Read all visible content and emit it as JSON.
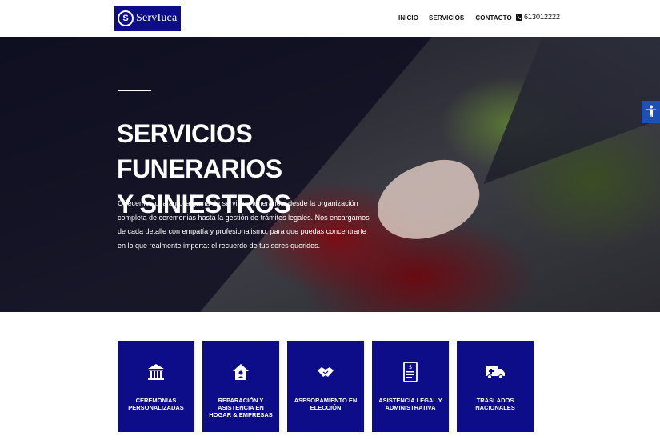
{
  "header": {
    "logo_text": "ServIuca",
    "nav": [
      {
        "label": "INICIO"
      },
      {
        "label": "SERVICIOS"
      },
      {
        "label": "CONTACTO"
      }
    ],
    "phone": "613012222"
  },
  "hero": {
    "title_line1": "SERVICIOS FUNERARIOS",
    "title_line2": "Y SINIESTROS",
    "description": "Ofrecemos una amplia gama de servicios funerarios, desde la organización completa de ceremonias hasta la gestión de trámites legales. Nos encargamos de cada detalle con empatía y profesionalismo, para que puedas concentrarte en lo que realmente importa: el recuerdo de tus seres queridos."
  },
  "services": [
    {
      "label": "CEREMONIAS PERSONALIZADAS",
      "icon": "bank-building-icon"
    },
    {
      "label": "REPARACIÓN Y ASISTENCIA EN HOGAR & EMPRESAS",
      "icon": "home-user-icon"
    },
    {
      "label": "ASESORAMIENTO EN ELECCIÓN",
      "icon": "handshake-icon"
    },
    {
      "label": "ASISTENCIA LEGAL Y ADMINISTRATIVA",
      "icon": "document-dollar-icon"
    },
    {
      "label": "TRASLADOS NACIONALES",
      "icon": "ambulance-icon"
    }
  ],
  "colors": {
    "brand": "#0d0d8a",
    "accessibility": "#1e4fb4"
  }
}
